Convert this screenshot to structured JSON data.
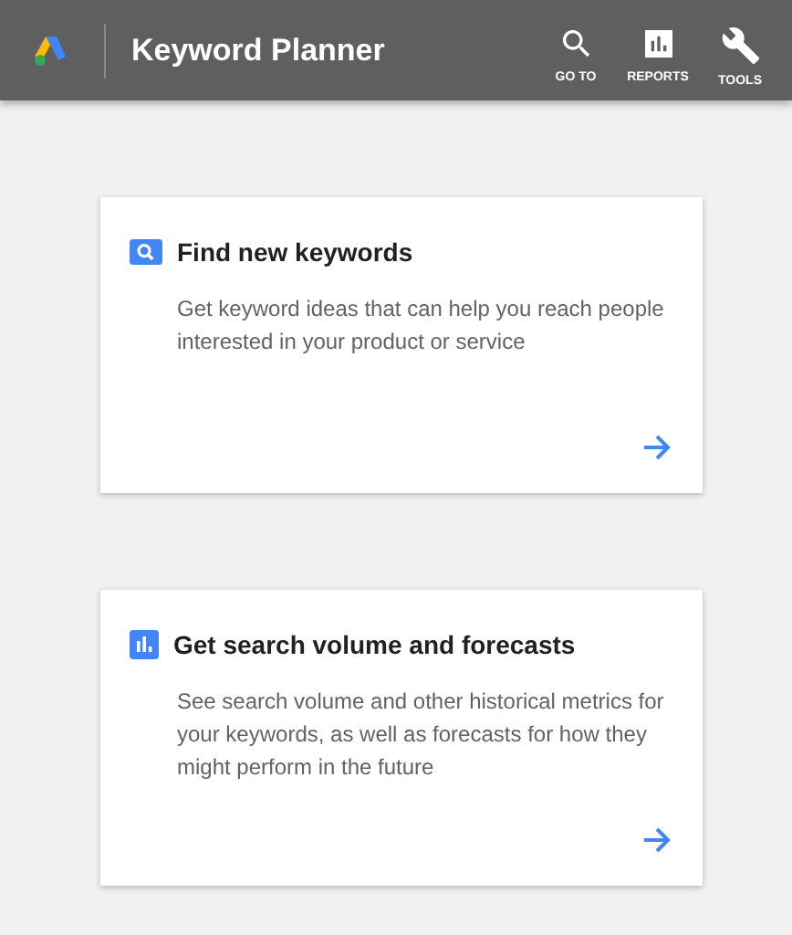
{
  "header": {
    "title": "Keyword Planner",
    "nav": [
      {
        "kind": "search",
        "label": "GO TO"
      },
      {
        "kind": "reports",
        "label": "REPORTS"
      },
      {
        "kind": "tools",
        "label": "TOOLS"
      }
    ]
  },
  "cards": [
    {
      "kind": "search",
      "title": "Find new keywords",
      "description": "Get keyword ideas that can help you reach people interested in your product or service"
    },
    {
      "kind": "chart",
      "title": "Get search volume and forecasts",
      "description": "See search volume and other historical metrics for your keywords, as well as forecasts for how they might perform in the future"
    }
  ]
}
